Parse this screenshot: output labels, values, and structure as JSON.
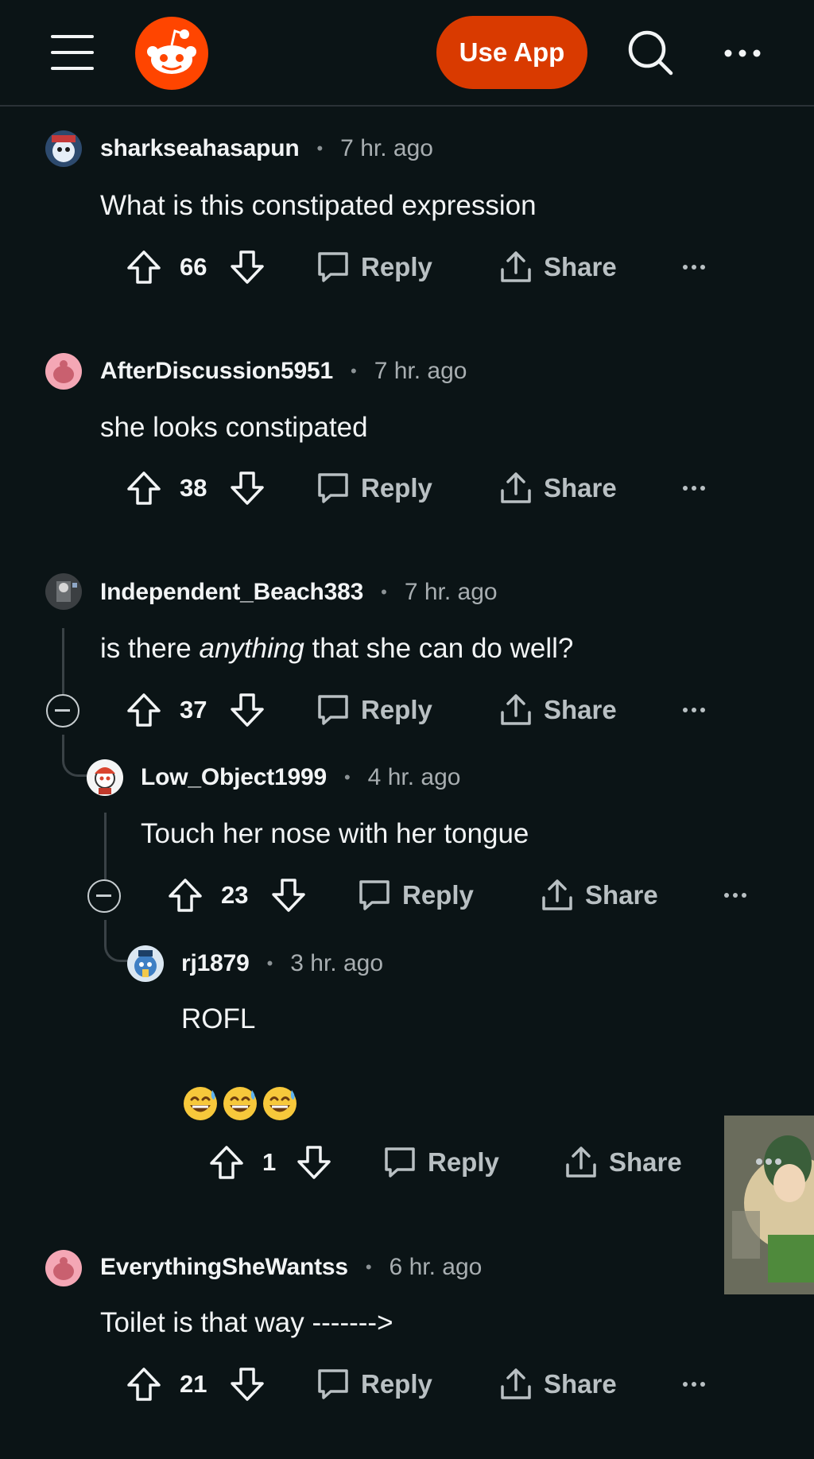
{
  "header": {
    "use_app_label": "Use App"
  },
  "comments": [
    {
      "username": "sharkseahasapun",
      "time": "7 hr. ago",
      "body": "What is this constipated expression",
      "votes": "66",
      "reply_label": "Reply",
      "share_label": "Share"
    },
    {
      "username": "AfterDiscussion5951",
      "time": "7 hr. ago",
      "body": "she looks constipated",
      "votes": "38",
      "reply_label": "Reply",
      "share_label": "Share"
    },
    {
      "username": "Independent_Beach383",
      "time": "7 hr. ago",
      "body_before": "is there ",
      "body_em": "anything",
      "body_after": " that she can do well?",
      "votes": "37",
      "reply_label": "Reply",
      "share_label": "Share"
    },
    {
      "username": "Low_Object1999",
      "time": "4 hr. ago",
      "body": "Touch her nose with her tongue",
      "votes": "23",
      "reply_label": "Reply",
      "share_label": "Share"
    },
    {
      "username": "rj1879",
      "time": "3 hr. ago",
      "body": "ROFL",
      "emoji_count": 3,
      "votes": "1",
      "reply_label": "Reply",
      "share_label": "Share"
    },
    {
      "username": "EverythingSheWantss",
      "time": "6 hr. ago",
      "body": "Toilet is that way ------->",
      "votes": "21",
      "reply_label": "Reply",
      "share_label": "Share"
    }
  ],
  "colors": {
    "background": "#0b1416",
    "brand": "#ff4500",
    "use_app_button": "#d93a00",
    "text": "#f2f4f5",
    "muted": "#a8aeb1"
  },
  "icons": [
    "menu-icon",
    "reddit-logo",
    "search-icon",
    "more-icon",
    "upvote-icon",
    "downvote-icon",
    "reply-icon",
    "share-icon",
    "collapse-icon",
    "laughing-emoji"
  ]
}
